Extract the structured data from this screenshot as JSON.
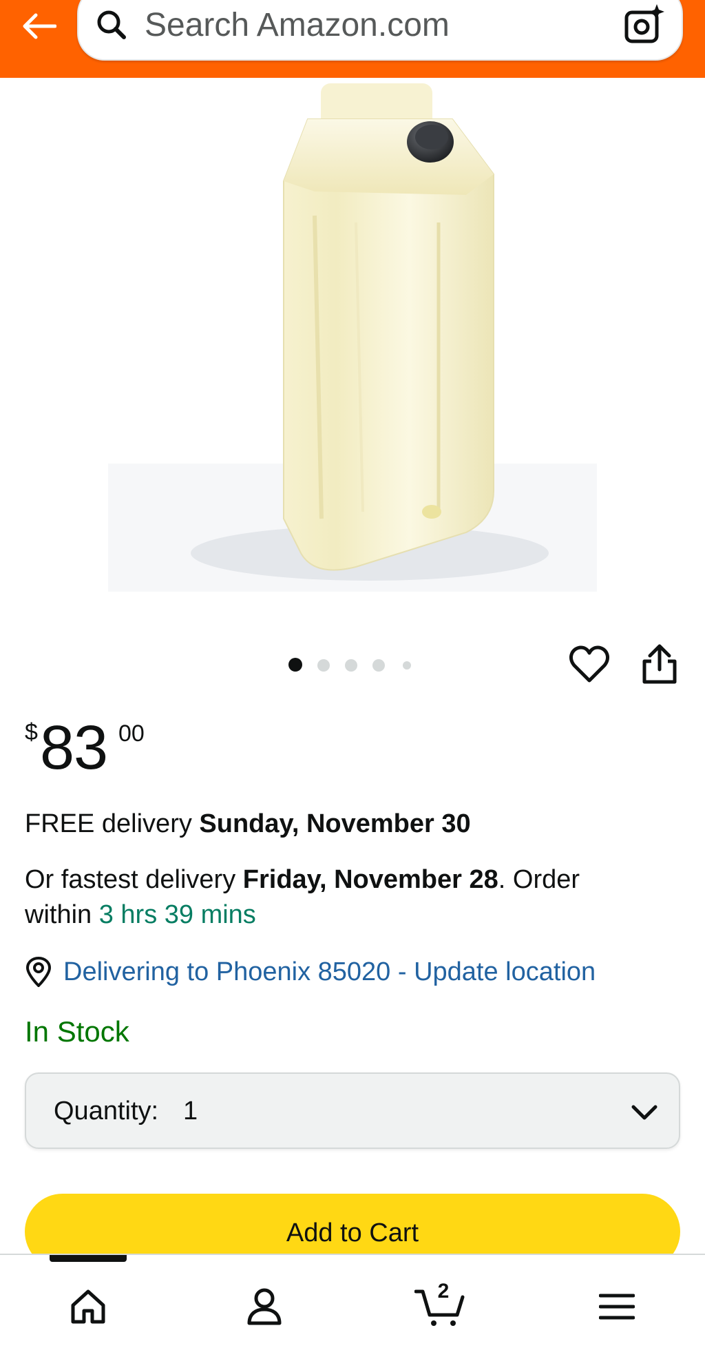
{
  "header": {
    "search_placeholder": "Search Amazon.com",
    "icons": {
      "back": "arrow-left-icon",
      "search": "search-icon",
      "camera": "camera-sparkle-icon"
    }
  },
  "gallery": {
    "image": "white plastic tank with black cap",
    "slide_count": 5,
    "active_slide": 0
  },
  "price": {
    "symbol": "$",
    "whole": "83",
    "fraction": "00"
  },
  "delivery": {
    "free_prefix": "FREE delivery ",
    "free_date": "Sunday, November 30",
    "fast_prefix": "Or fastest delivery ",
    "fast_date": "Friday, November 28",
    "fast_suffix": ". Order",
    "within_prefix": "within ",
    "countdown": "3 hrs 39 mins",
    "location_text": "Delivering to Phoenix 85020 - Update location"
  },
  "stock": {
    "status": "In Stock"
  },
  "quantity": {
    "label": "Quantity:",
    "value": "1"
  },
  "actions": {
    "add_to_cart": "Add to Cart"
  },
  "bottom_nav": {
    "cart_count": "2",
    "items": [
      "home-icon",
      "account-icon",
      "cart-icon",
      "menu-icon"
    ]
  },
  "colors": {
    "header": "#ff6200",
    "add_to_cart": "#ffd814",
    "link": "#2162a1",
    "countdown": "#067d62",
    "in_stock": "#007600"
  }
}
